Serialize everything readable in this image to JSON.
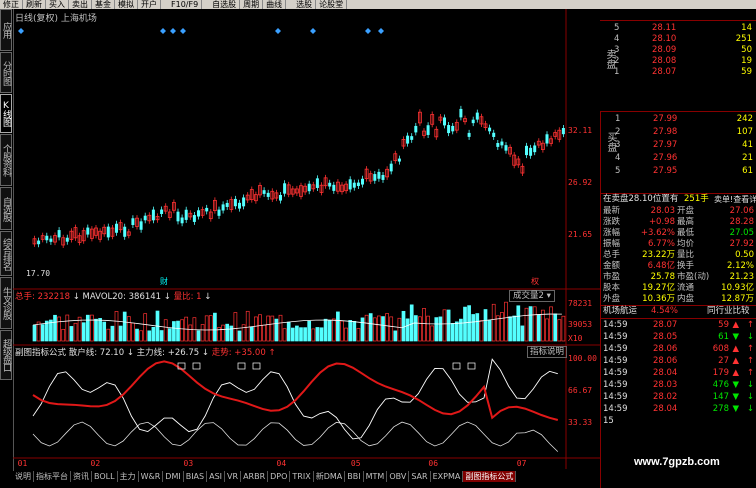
{
  "toolbar": {
    "items": [
      "修正",
      "刷新",
      "买入",
      "卖出",
      "基金",
      "模拟",
      "开户",
      "",
      "F10/F9",
      "",
      "自选股",
      "周期",
      "曲线",
      "",
      "选股",
      "论股堂"
    ]
  },
  "left_tabs": [
    "应用",
    "分时图",
    "K线图",
    "个股资料",
    "自选股",
    "综合排名",
    "牛叉诊股",
    "超级盘口"
  ],
  "chart_title": "日线(复权) 上海机场",
  "price_axis": {
    "labels": [
      "32.11",
      "26.92",
      "21.65"
    ],
    "low_label": "17.70",
    "event_labels": [
      "财",
      "权"
    ]
  },
  "volume_header": {
    "total_label": "总手: 232218",
    "mavol_label": "MAVOL20: 386141",
    "ratio_label": "量比: 1",
    "dropdown_label": "成交量2"
  },
  "volume_axis": {
    "labels": [
      "78231",
      "39053",
      "X10"
    ]
  },
  "indicator_header": {
    "title": "副图指标公式",
    "sanhu": "散户线: 72.10",
    "zhuli": "主力线: +26.75",
    "zoushi": "走势: +35.00",
    "help": "指标说明"
  },
  "indicator_axis": {
    "labels": [
      "100.00",
      "66.67",
      "33.33"
    ]
  },
  "time_axis": {
    "labels": [
      "01",
      "02",
      "03",
      "04",
      "05",
      "06",
      "07"
    ]
  },
  "bottom_tabs": [
    "说明",
    "指标平台",
    "资讯",
    "BOLL",
    "主力",
    "W&R",
    "DMI",
    "BIAS",
    "ASI",
    "VR",
    "ARBR",
    "DPO",
    "TRIX",
    "新DMA",
    "BBI",
    "MTM",
    "OBV",
    "SAR",
    "EXPMA",
    "副图指标公式"
  ],
  "order_book": {
    "sell_label": "卖盘",
    "buy_label": "买盘",
    "sell": [
      {
        "n": "5",
        "p": "28.11",
        "v": "14"
      },
      {
        "n": "4",
        "p": "28.10",
        "v": "251"
      },
      {
        "n": "3",
        "p": "28.09",
        "v": "50"
      },
      {
        "n": "2",
        "p": "28.08",
        "v": "19"
      },
      {
        "n": "1",
        "p": "28.07",
        "v": "59"
      }
    ],
    "buy": [
      {
        "n": "1",
        "p": "27.99",
        "v": "242"
      },
      {
        "n": "2",
        "p": "27.98",
        "v": "107"
      },
      {
        "n": "3",
        "p": "27.97",
        "v": "41"
      },
      {
        "n": "4",
        "p": "27.96",
        "v": "21"
      },
      {
        "n": "5",
        "p": "27.95",
        "v": "61"
      }
    ]
  },
  "notice": {
    "text": "在卖盘28.10位置有",
    "amount": "251手",
    "link": "卖单!查看详细"
  },
  "quote": [
    {
      "l1": "最新",
      "v1": "28.03",
      "l2": "开盘",
      "v2": "27.06"
    },
    {
      "l1": "涨跌",
      "v1": "+0.98",
      "l2": "最高",
      "v2": "28.28"
    },
    {
      "l1": "涨幅",
      "v1": "+3.62%",
      "l2": "最低",
      "v2": "27.05"
    },
    {
      "l1": "振幅",
      "v1": "6.77%",
      "l2": "均价",
      "v2": "27.92"
    },
    {
      "l1": "总手",
      "v1": "23.22万",
      "l2": "量比",
      "v2": "0.50"
    },
    {
      "l1": "金额",
      "v1": "6.48亿",
      "l2": "换手",
      "v2": "2.12%"
    },
    {
      "l1": "市盈",
      "v1": "25.78",
      "l2": "市盈(动)",
      "v2": "21.23"
    },
    {
      "l1": "股本",
      "v1": "19.27亿",
      "l2": "流通",
      "v2": "10.93亿"
    },
    {
      "l1": "外盘",
      "v1": "10.36万",
      "l2": "内盘",
      "v2": "12.87万"
    }
  ],
  "sector": {
    "name": "机场航运",
    "change": "4.54%",
    "rank": "同行业比较"
  },
  "ticks": [
    {
      "t": "14:59",
      "p": "28.07",
      "v": "59",
      "d": "up"
    },
    {
      "t": "14:59",
      "p": "28.05",
      "v": "61",
      "d": "down"
    },
    {
      "t": "14:59",
      "p": "28.06",
      "v": "608",
      "d": "up"
    },
    {
      "t": "14:59",
      "p": "28.06",
      "v": "27",
      "d": "up"
    },
    {
      "t": "14:59",
      "p": "28.04",
      "v": "179",
      "d": "up"
    },
    {
      "t": "14:59",
      "p": "28.03",
      "v": "476",
      "d": "down"
    },
    {
      "t": "14:59",
      "p": "28.02",
      "v": "147",
      "d": "down"
    },
    {
      "t": "14:59",
      "p": "28.04",
      "v": "278",
      "d": "down"
    },
    {
      "t": "15",
      "p": "",
      "v": "",
      "d": ""
    }
  ],
  "watermark": "www.7gpzb.com",
  "colors": {
    "up": "#ff3232",
    "down": "#00ffff",
    "ma": "#ffffff",
    "red_line": "#ff2020"
  }
}
